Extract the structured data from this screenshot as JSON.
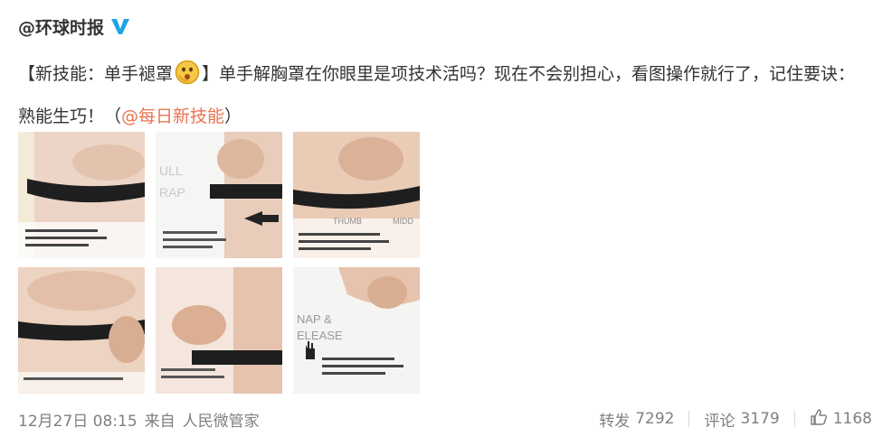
{
  "post": {
    "author": "@环球时报",
    "verified_icon": "verified-v-icon",
    "text_prefix": "【新技能：单手褪罩",
    "emoji_icon": "hushed-face-emoji",
    "text_main": "】单手解胸罩在你眼里是项技术活吗？现在不会别担心，看图操作就行了，记住要诀：熟能生巧！（",
    "mention": "@每日新技能",
    "text_suffix": "）"
  },
  "images": {
    "count": 6,
    "panel_texts": [
      "ULL",
      "RAP",
      "THUMB",
      "MIDD",
      "NAP &",
      "ELEASE"
    ]
  },
  "footer": {
    "timestamp": "12月27日 08:15",
    "source_prefix": "来自",
    "source": "人民微管家",
    "repost_label": "转发",
    "repost_count": "7292",
    "comment_label": "评论",
    "comment_count": "3179",
    "like_icon": "thumbs-up-icon",
    "like_count": "1168"
  },
  "colors": {
    "link": "#eb7350",
    "meta": "#808080",
    "verified": "#1ea5e6"
  }
}
